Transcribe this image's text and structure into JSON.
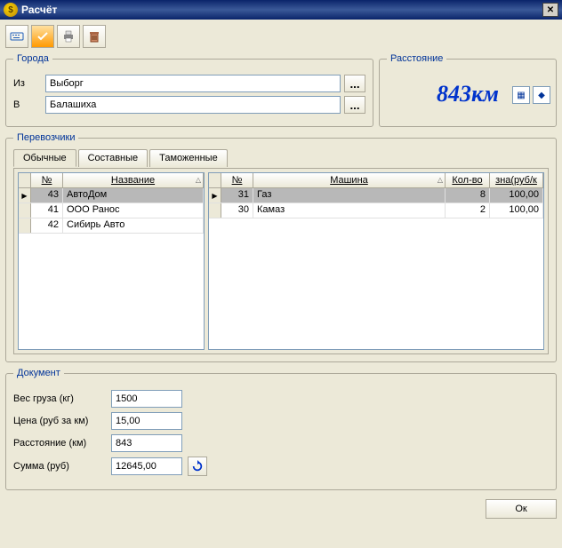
{
  "window": {
    "title": "Расчёт"
  },
  "cities": {
    "legend": "Города",
    "from_label": "Из",
    "to_label": "В",
    "from_value": "Выборг",
    "to_value": "Балашиха"
  },
  "distance": {
    "legend": "Расстояние",
    "value": "843км"
  },
  "carriers": {
    "legend": "Перевозчики",
    "tabs": [
      "Обычные",
      "Составные",
      "Таможенные"
    ],
    "left": {
      "cols": {
        "no": "№",
        "name": "Название"
      },
      "rows": [
        {
          "no": "43",
          "name": "АвтоДом",
          "selected": true
        },
        {
          "no": "41",
          "name": "ООО Ранос"
        },
        {
          "no": "42",
          "name": "Сибирь Авто"
        }
      ]
    },
    "right": {
      "cols": {
        "no": "№",
        "car": "Машина",
        "qty": "Кол-во",
        "price": "зна(руб/к"
      },
      "rows": [
        {
          "no": "31",
          "name": "Газ",
          "qty": "8",
          "price": "100,00",
          "selected": true
        },
        {
          "no": "30",
          "name": "Камаз",
          "qty": "2",
          "price": "100,00"
        }
      ]
    }
  },
  "document": {
    "legend": "Документ",
    "weight_label": "Вес груза (кг)",
    "weight_value": "1500",
    "price_label": "Цена (руб за км)",
    "price_value": "15,00",
    "distance_label": "Расстояние (км)",
    "distance_value": "843",
    "sum_label": "Сумма (руб)",
    "sum_value": "12645,00"
  },
  "buttons": {
    "ok": "Ок",
    "ellipsis": "..."
  }
}
